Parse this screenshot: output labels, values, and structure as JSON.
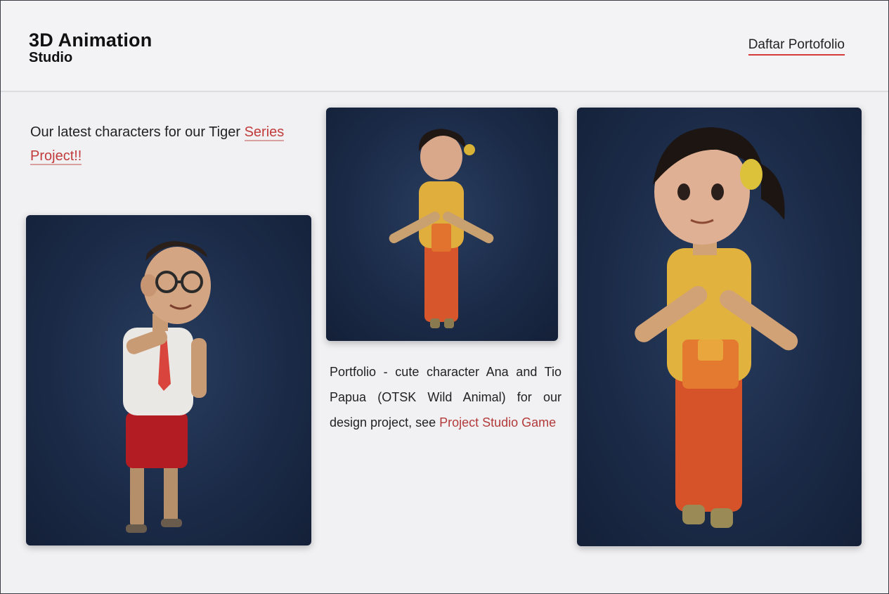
{
  "header": {
    "brand_title": "3D Animation",
    "brand_subtitle": "Studio",
    "nav_link": "Daftar Portofolio"
  },
  "intro": {
    "text": "Our latest characters for our Tiger",
    "accent_text": "Series Project!!"
  },
  "description": {
    "text": "Portfolio - cute character Ana and Tio Papua (OTSK Wild Animal) for our design project, see ",
    "accent_text": "Project Studio Game"
  },
  "images": {
    "boy": "3D cartoon boy character in white shirt and red shorts",
    "girl_small": "3D cartoon girl character in yellow top, T-pose",
    "girl_large": "3D cartoon girl character in yellow top and orange skirt, T-pose close-up"
  },
  "colors": {
    "accent": "#d43a3a",
    "card_background": "#1b2b48"
  }
}
